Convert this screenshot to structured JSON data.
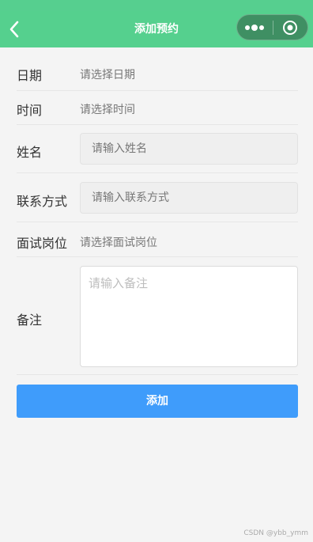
{
  "header": {
    "title": "添加预约",
    "back_icon": "chevron-left-icon",
    "more_icon": "more-dots-icon",
    "close_icon": "target-close-icon"
  },
  "form": {
    "date": {
      "label": "日期",
      "placeholder": "请选择日期"
    },
    "time": {
      "label": "时间",
      "placeholder": "请选择时间"
    },
    "name": {
      "label": "姓名",
      "placeholder": "请输入姓名"
    },
    "contact": {
      "label": "联系方式",
      "placeholder": "请输入联系方式"
    },
    "position": {
      "label": "面试岗位",
      "placeholder": "请选择面试岗位"
    },
    "remark": {
      "label": "备注",
      "placeholder": "请输入备注"
    }
  },
  "submit_label": "添加",
  "watermark": "CSDN @ybb_ymm",
  "colors": {
    "navbar": "#55d08e",
    "button": "#3f9cfb",
    "background": "#f4f4f4"
  }
}
